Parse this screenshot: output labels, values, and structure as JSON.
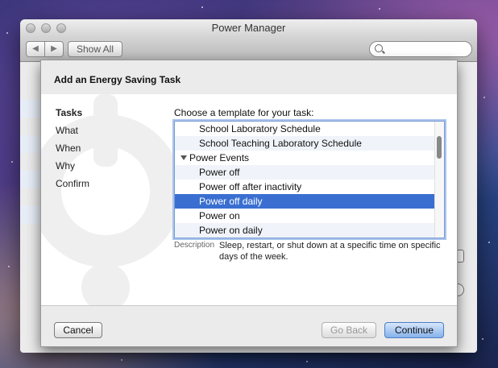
{
  "window": {
    "title": "Power Manager",
    "nav_back_label": "◀",
    "nav_forward_label": "▶",
    "show_all_label": "Show All",
    "search_placeholder": ""
  },
  "sheet": {
    "title": "Add an Energy Saving Task",
    "steps": [
      {
        "label": "Tasks",
        "active": true
      },
      {
        "label": "What",
        "active": false
      },
      {
        "label": "When",
        "active": false
      },
      {
        "label": "Why",
        "active": false
      },
      {
        "label": "Confirm",
        "active": false
      }
    ],
    "prompt": "Choose a template for your task:",
    "templates": [
      {
        "label": "School Laboratory Schedule",
        "type": "item"
      },
      {
        "label": "School Teaching Laboratory Schedule",
        "type": "item"
      },
      {
        "label": "Power Events",
        "type": "group"
      },
      {
        "label": "Power off",
        "type": "item"
      },
      {
        "label": "Power off after inactivity",
        "type": "item"
      },
      {
        "label": "Power off daily",
        "type": "item",
        "selected": true
      },
      {
        "label": "Power on",
        "type": "item"
      },
      {
        "label": "Power on daily",
        "type": "item"
      }
    ],
    "description_label": "Description",
    "description_text": "Sleep, restart, or shut down at a specific time on specific days of the week.",
    "buttons": {
      "cancel": "Cancel",
      "go_back": "Go Back",
      "continue": "Continue"
    }
  },
  "colors": {
    "selection": "#3a6fd1",
    "focus_ring": "#a9c3ec"
  }
}
